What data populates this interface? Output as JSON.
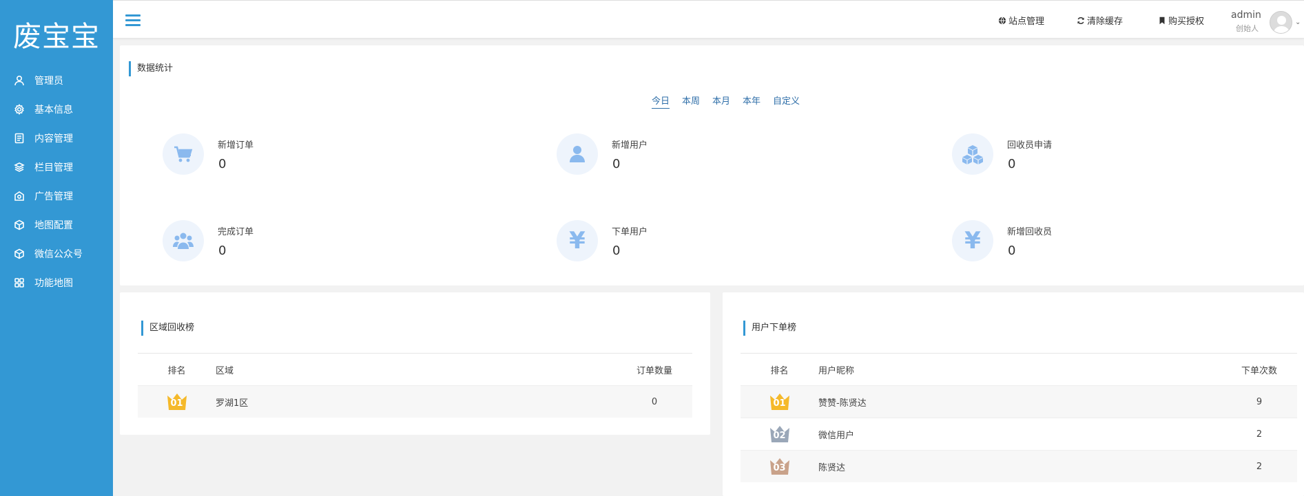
{
  "app": {
    "logo": "废宝宝"
  },
  "sidebar": {
    "items": [
      {
        "label": "管理员",
        "icon": "user-icon"
      },
      {
        "label": "基本信息",
        "icon": "gear-icon"
      },
      {
        "label": "内容管理",
        "icon": "document-icon"
      },
      {
        "label": "栏目管理",
        "icon": "layers-icon"
      },
      {
        "label": "广告管理",
        "icon": "ad-icon"
      },
      {
        "label": "地图配置",
        "icon": "cube-icon"
      },
      {
        "label": "微信公众号",
        "icon": "cube-icon"
      },
      {
        "label": "功能地图",
        "icon": "grid-icon"
      }
    ]
  },
  "header": {
    "site_manage": "站点管理",
    "clear_cache": "清除缓存",
    "buy_license": "购买授权",
    "user_name": "admin",
    "user_role": "创始人"
  },
  "stats": {
    "title": "数据统计",
    "tabs": [
      "今日",
      "本周",
      "本月",
      "本年",
      "自定义"
    ],
    "active_tab": "今日",
    "cards": [
      {
        "label": "新增订单",
        "value": "0",
        "icon": "cart-icon"
      },
      {
        "label": "新增用户",
        "value": "0",
        "icon": "person-icon"
      },
      {
        "label": "回收员申请",
        "value": "0",
        "icon": "boxes-icon"
      },
      {
        "label": "完成订单",
        "value": "0",
        "icon": "group-icon"
      },
      {
        "label": "下单用户",
        "value": "0",
        "icon": "yen-icon"
      },
      {
        "label": "新增回收员",
        "value": "0",
        "icon": "yen-icon"
      }
    ]
  },
  "region_rank": {
    "title": "区域回收榜",
    "headers": {
      "rank": "排名",
      "name": "区域",
      "count": "订单数量"
    },
    "rows": [
      {
        "rank": "01",
        "name": "罗湖1区",
        "count": "0"
      }
    ]
  },
  "user_rank": {
    "title": "用户下单榜",
    "headers": {
      "rank": "排名",
      "name": "用户昵称",
      "count": "下单次数"
    },
    "rows": [
      {
        "rank": "01",
        "name": "赞赞-陈贤达",
        "count": "9"
      },
      {
        "rank": "02",
        "name": "微信用户",
        "count": "2"
      },
      {
        "rank": "03",
        "name": "陈贤达",
        "count": "2"
      }
    ]
  },
  "colors": {
    "sidebar": "#3398d4",
    "accent": "#3398d4",
    "tab_link": "#2e6ea8",
    "icon_fill": "#8ab9ee",
    "gold": "#f5b92a",
    "silver": "#9aa7b8",
    "bronze": "#c9a28a"
  }
}
